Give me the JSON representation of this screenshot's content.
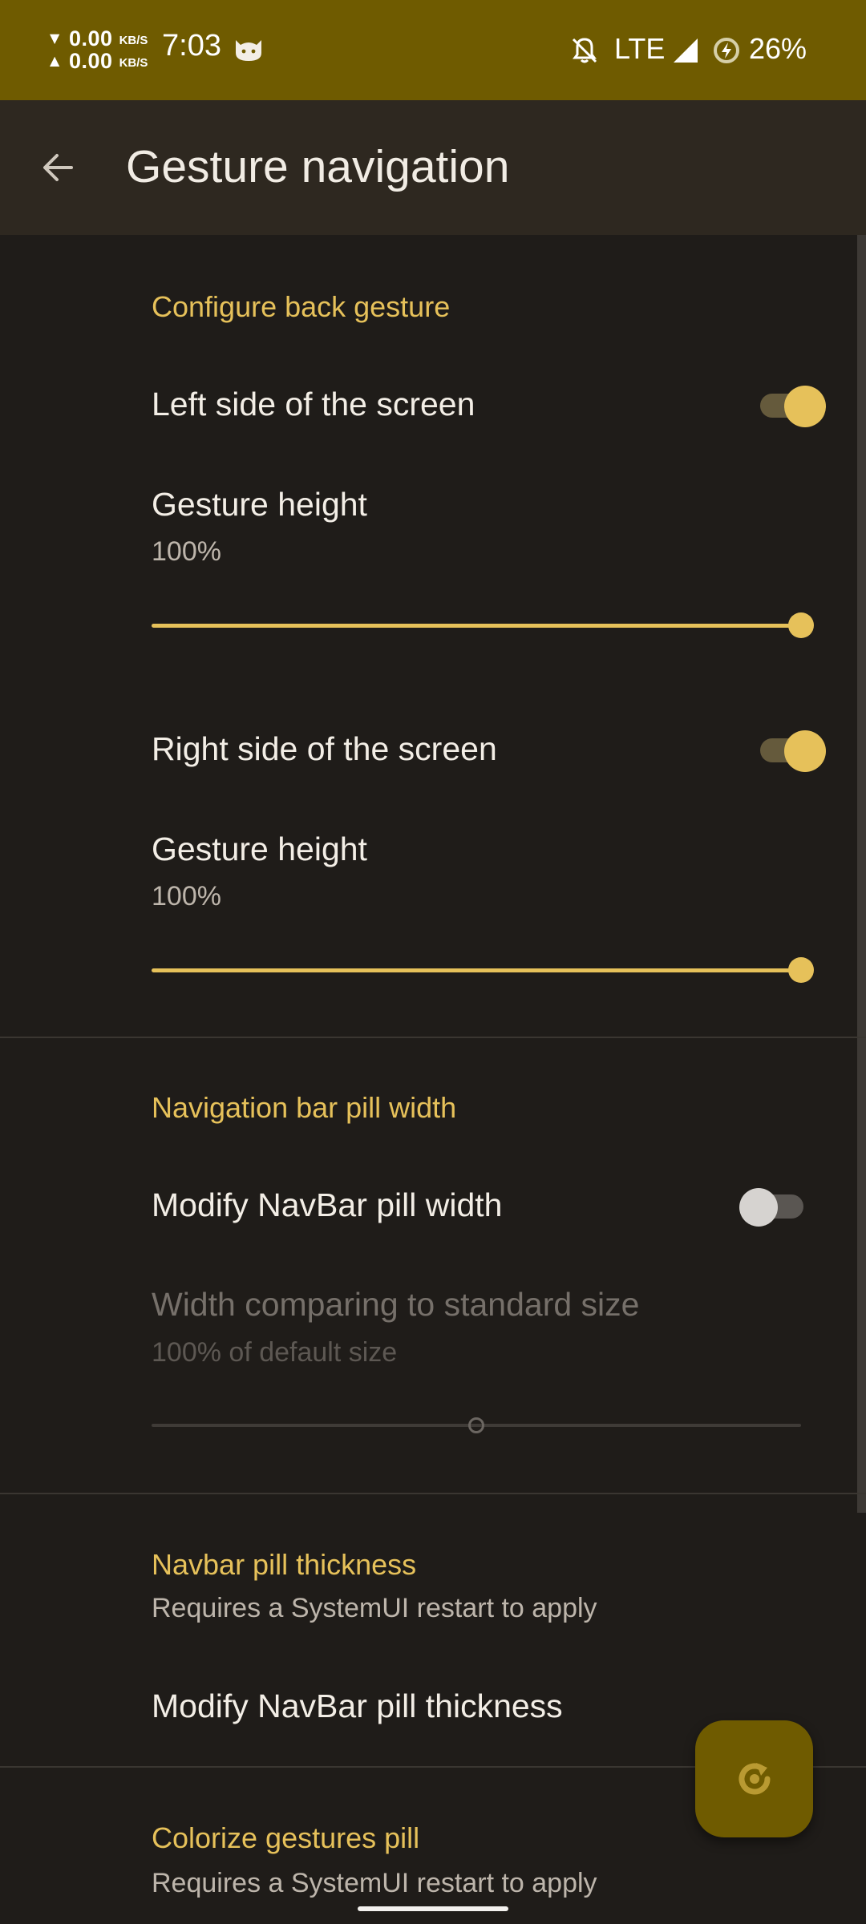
{
  "status_bar": {
    "net_down_value": "0.00",
    "net_down_unit": "KB/S",
    "net_up_value": "0.00",
    "net_up_unit": "KB/S",
    "time": "7:03",
    "network": "LTE",
    "battery": "26%"
  },
  "app_bar": {
    "title": "Gesture navigation"
  },
  "sections": {
    "back_gesture": {
      "header": "Configure back gesture",
      "left_label": "Left side of the screen",
      "left_enabled": true,
      "left_height_label": "Gesture height",
      "left_height_value": "100%",
      "left_height_fraction": 1.0,
      "right_label": "Right side of the screen",
      "right_enabled": true,
      "right_height_label": "Gesture height",
      "right_height_value": "100%",
      "right_height_fraction": 1.0
    },
    "pill_width": {
      "header": "Navigation bar pill width",
      "modify_label": "Modify NavBar pill width",
      "modify_enabled": false,
      "width_label": "Width comparing to standard size",
      "width_value": "100% of default size",
      "width_fraction": 0.5
    },
    "pill_thickness": {
      "header": "Navbar pill thickness",
      "subtitle": "Requires a SystemUI restart to apply",
      "modify_label": "Modify NavBar pill thickness"
    },
    "colorize": {
      "header": "Colorize gestures pill",
      "subtitle": "Requires a SystemUI restart to apply"
    }
  },
  "colors": {
    "accent": "#e6c15a",
    "status_bar": "#6f5b00",
    "background": "#1f1c19"
  },
  "icons": {
    "back": "arrow-back-icon",
    "fab": "restart-icon",
    "notifications": "bell-off-icon",
    "signal": "signal-icon",
    "battery": "battery-icon",
    "app": "cat-icon"
  }
}
